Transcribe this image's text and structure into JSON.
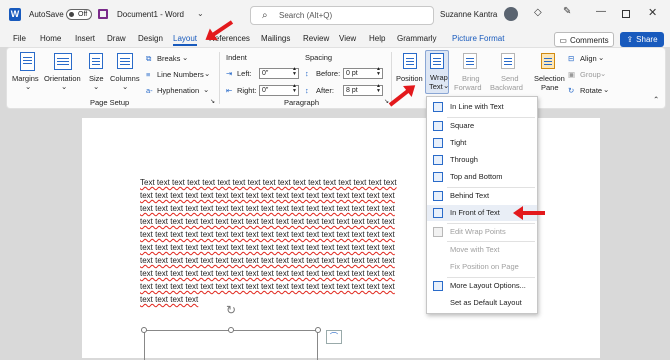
{
  "titlebar": {
    "autosave_label": "AutoSave",
    "autosave_state": "Off",
    "doc_title": "Document1 - Word",
    "search_placeholder": "Search (Alt+Q)",
    "user_name": "Suzanne Kantra"
  },
  "tabs": [
    "File",
    "Home",
    "Insert",
    "Draw",
    "Design",
    "Layout",
    "References",
    "Mailings",
    "Review",
    "View",
    "Help",
    "Grammarly",
    "Picture Format"
  ],
  "active_tab": "Layout",
  "comments_label": "Comments",
  "share_label": "Share",
  "page_setup": {
    "margins": "Margins",
    "orientation": "Orientation",
    "size": "Size",
    "columns": "Columns",
    "breaks": "Breaks",
    "line_numbers": "Line Numbers",
    "hyphenation": "Hyphenation",
    "group_label": "Page Setup"
  },
  "paragraph": {
    "indent_label": "Indent",
    "left_label": "Left:",
    "left_value": "0\"",
    "right_label": "Right:",
    "right_value": "0\"",
    "spacing_label": "Spacing",
    "before_label": "Before:",
    "before_value": "0 pt",
    "after_label": "After:",
    "after_value": "8 pt",
    "group_label": "Paragraph"
  },
  "arrange": {
    "position": "Position",
    "wrap_line1": "Wrap",
    "wrap_line2": "Text",
    "bring_line1": "Bring",
    "bring_line2": "Forward",
    "send_line1": "Send",
    "send_line2": "Backward",
    "selection_line1": "Selection",
    "selection_line2": "Pane",
    "align": "Align",
    "group": "Group",
    "rotate": "Rotate"
  },
  "document": {
    "first_line": "Text text text text text text text text text text text text text text text text text",
    "line": "text text text text text text text text text text text text text text text text text",
    "last_line": "text text text text"
  },
  "wrap_menu": [
    {
      "label": "In Line with Text",
      "enabled": true
    },
    {
      "label": "Square",
      "enabled": true
    },
    {
      "label": "Tight",
      "enabled": true
    },
    {
      "label": "Through",
      "enabled": true
    },
    {
      "label": "Top and Bottom",
      "enabled": true
    },
    {
      "label": "Behind Text",
      "enabled": true
    },
    {
      "label": "In Front of Text",
      "enabled": true
    },
    {
      "label": "Edit Wrap Points",
      "enabled": false
    },
    {
      "label": "Move with Text",
      "enabled": false
    },
    {
      "label": "Fix Position on Page",
      "enabled": false
    },
    {
      "label": "More Layout Options...",
      "enabled": true
    },
    {
      "label": "Set as Default Layout",
      "enabled": true
    }
  ],
  "colors": {
    "accent": "#185abd",
    "annotation_arrow": "#e3191c",
    "spellcheck_underline": "#e0251b"
  }
}
